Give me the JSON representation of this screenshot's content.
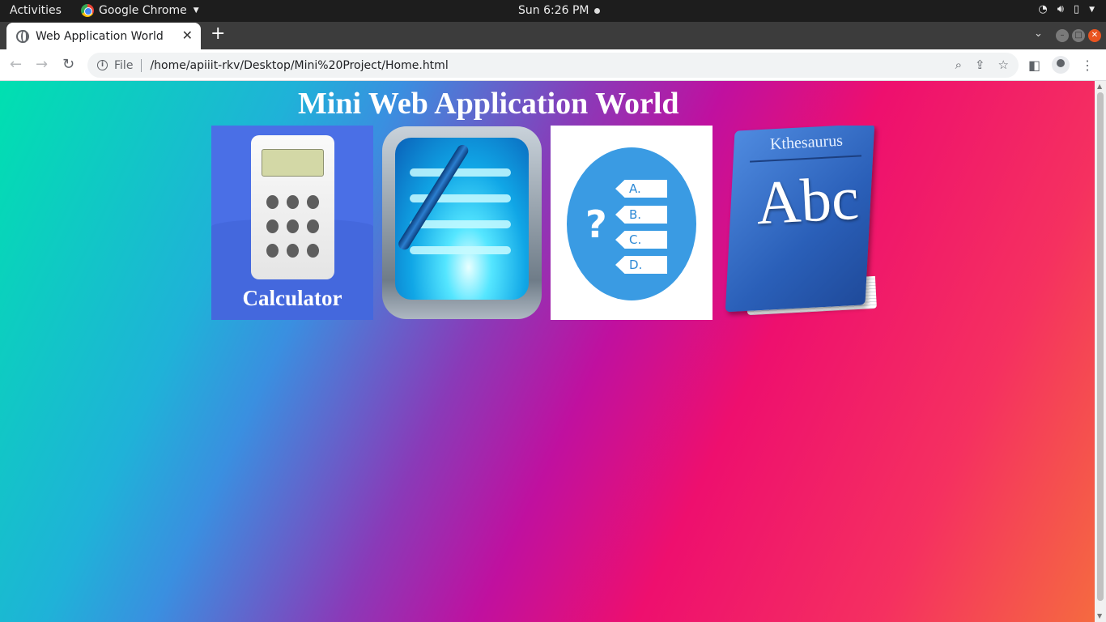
{
  "system_bar": {
    "activities": "Activities",
    "app_name": "Google Chrome",
    "clock": "Sun  6:26 PM"
  },
  "browser": {
    "tab_title": "Web Application World",
    "new_tab": "+",
    "url_scheme": "File",
    "url": "/home/apiiit-rkv/Desktop/Mini%20Project/Home.html"
  },
  "page": {
    "title": "Mini Web Application World",
    "apps": [
      {
        "name": "calculator",
        "caption": "Calculator"
      },
      {
        "name": "notes"
      },
      {
        "name": "quiz",
        "choices": [
          "A.",
          "B.",
          "C.",
          "D."
        ],
        "question_mark": "?"
      },
      {
        "name": "thesaurus",
        "book_title": "Kthesaurus",
        "cover_text": "Abc"
      }
    ]
  },
  "colors": {
    "gradient_start": "#00e0b0",
    "gradient_mid": "#c0109f",
    "gradient_end": "#f56a40",
    "calculator_bg": "#4a6fe6",
    "quiz_circle": "#3a9be3"
  }
}
